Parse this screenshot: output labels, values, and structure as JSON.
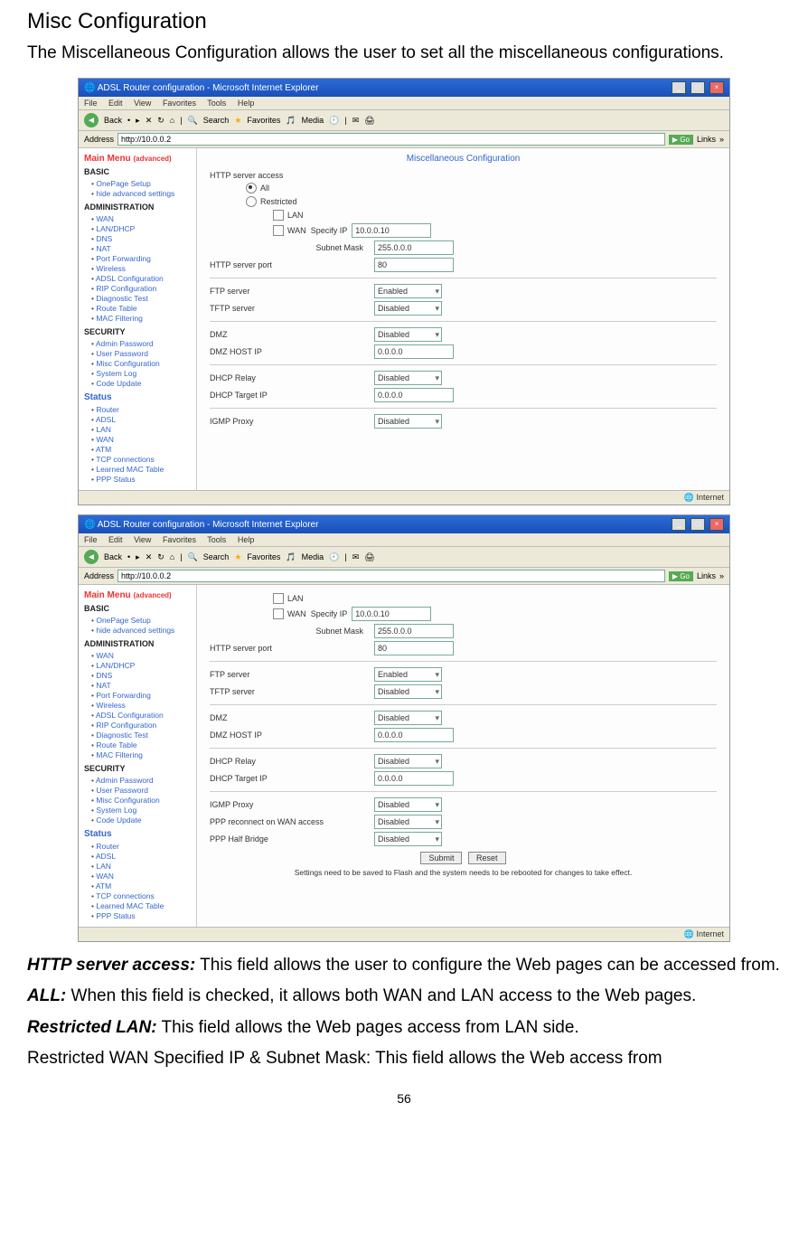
{
  "page": {
    "heading": "Misc Configuration",
    "intro": "The Miscellaneous Configuration allows the user to set all the miscellaneous configurations.",
    "page_number": "56"
  },
  "shot": {
    "title": "ADSL Router configuration - Microsoft Internet Explorer",
    "menu": {
      "file": "File",
      "edit": "Edit",
      "view": "View",
      "fav": "Favorites",
      "tools": "Tools",
      "help": "Help"
    },
    "tool": {
      "back": "Back",
      "search": "Search",
      "favorites": "Favorites",
      "media": "Media"
    },
    "addr_label": "Address",
    "addr_value": "http://10.0.0.2",
    "go": "Go",
    "links": "Links",
    "statusbar": "Internet"
  },
  "sidebar": {
    "main_menu": "Main Menu",
    "basic": "BASIC",
    "basic_items": [
      "OnePage Setup",
      "hide advanced settings"
    ],
    "admin": "ADMINISTRATION",
    "admin_items": [
      "WAN",
      "LAN/DHCP",
      "DNS",
      "NAT",
      "Port Forwarding",
      "Wireless",
      "ADSL Configuration",
      "RIP Configuration",
      "Diagnostic Test",
      "Route Table",
      "MAC Filtering"
    ],
    "security": "SECURITY",
    "security_items": [
      "Admin Password",
      "User Password",
      "Misc Configuration",
      "System Log",
      "Code Update"
    ],
    "status": "Status",
    "status_items": [
      "Router",
      "ADSL",
      "LAN",
      "WAN",
      "ATM",
      "TCP connections",
      "Learned MAC Table",
      "PPP Status"
    ]
  },
  "cfg": {
    "panel_title": "Miscellaneous Configuration",
    "http_access": "HTTP server access",
    "all": "All",
    "restricted": "Restricted",
    "lan": "LAN",
    "wan": "WAN",
    "specify_ip": "Specify IP",
    "specify_ip_val": "10.0.0.10",
    "subnet": "Subnet Mask",
    "subnet_val": "255.0.0.0",
    "http_port": "HTTP server port",
    "http_port_val": "80",
    "ftp": "FTP server",
    "ftp_val": "Enabled",
    "tftp": "TFTP server",
    "tftp_val": "Disabled",
    "dmz": "DMZ",
    "dmz_val": "Disabled",
    "dmz_host": "DMZ HOST IP",
    "dmz_host_val": "0.0.0.0",
    "dhcp_relay": "DHCP Relay",
    "dhcp_relay_val": "Disabled",
    "dhcp_target": "DHCP Target IP",
    "dhcp_target_val": "0.0.0.0",
    "igmp": "IGMP Proxy",
    "igmp_val": "Disabled",
    "ppp_reconnect": "PPP reconnect on WAN access",
    "ppp_reconnect_val": "Disabled",
    "half_bridge": "PPP Half Bridge",
    "half_bridge_val": "Disabled",
    "submit": "Submit",
    "reset": "Reset",
    "save_note": "Settings need to be saved to Flash and the system needs to be rebooted for changes to take effect."
  },
  "body": {
    "l1a": "HTTP server access:",
    "l1b": " This field allows the user to configure the Web pages can be accessed from.",
    "l2a": "ALL:",
    "l2b": " When this field is checked, it allows both WAN and LAN access to the Web pages.",
    "l3a": "Restricted LAN:",
    "l3b": " This field allows the Web pages access from LAN side.",
    "l4": "Restricted WAN Specified IP & Subnet Mask: This field allows the Web access from"
  }
}
